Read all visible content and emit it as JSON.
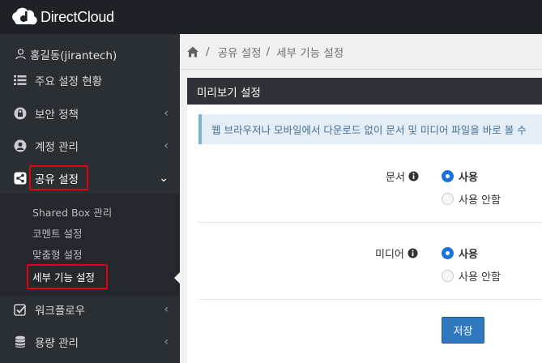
{
  "app": {
    "brand": "DirectCloud"
  },
  "user": {
    "name": "홍길동(jirantech)"
  },
  "sidebar": {
    "items": [
      {
        "label": "주요 설정 현황"
      },
      {
        "label": "보안 정책"
      },
      {
        "label": "계정 관리"
      },
      {
        "label": "공유 설정"
      },
      {
        "label": "워크플로우"
      },
      {
        "label": "용량 관리"
      }
    ],
    "sub_items": [
      {
        "label": "Shared Box 관리"
      },
      {
        "label": "코멘트 설정"
      },
      {
        "label": "맞춤형 설정"
      },
      {
        "label": "세부 기능 설정"
      }
    ]
  },
  "breadcrumb": {
    "items": [
      "공유 설정",
      "세부 기능 설정"
    ],
    "separator": "/"
  },
  "panel": {
    "title": "미리보기 설정",
    "notice": "웹 브라우저나 모바일에서 다운로드 없이 문서 및 미디어 파일을 바로 볼 수",
    "settings": [
      {
        "label": "문서",
        "options": [
          {
            "label": "사용",
            "selected": true
          },
          {
            "label": "사용 안함",
            "selected": false
          }
        ]
      },
      {
        "label": "미디어",
        "options": [
          {
            "label": "사용",
            "selected": true
          },
          {
            "label": "사용 안함",
            "selected": false
          }
        ]
      }
    ],
    "save_label": "저장"
  },
  "colors": {
    "accent": "#2f78bf",
    "highlight": "#e3000f",
    "sidebar": "#2a2f34"
  }
}
